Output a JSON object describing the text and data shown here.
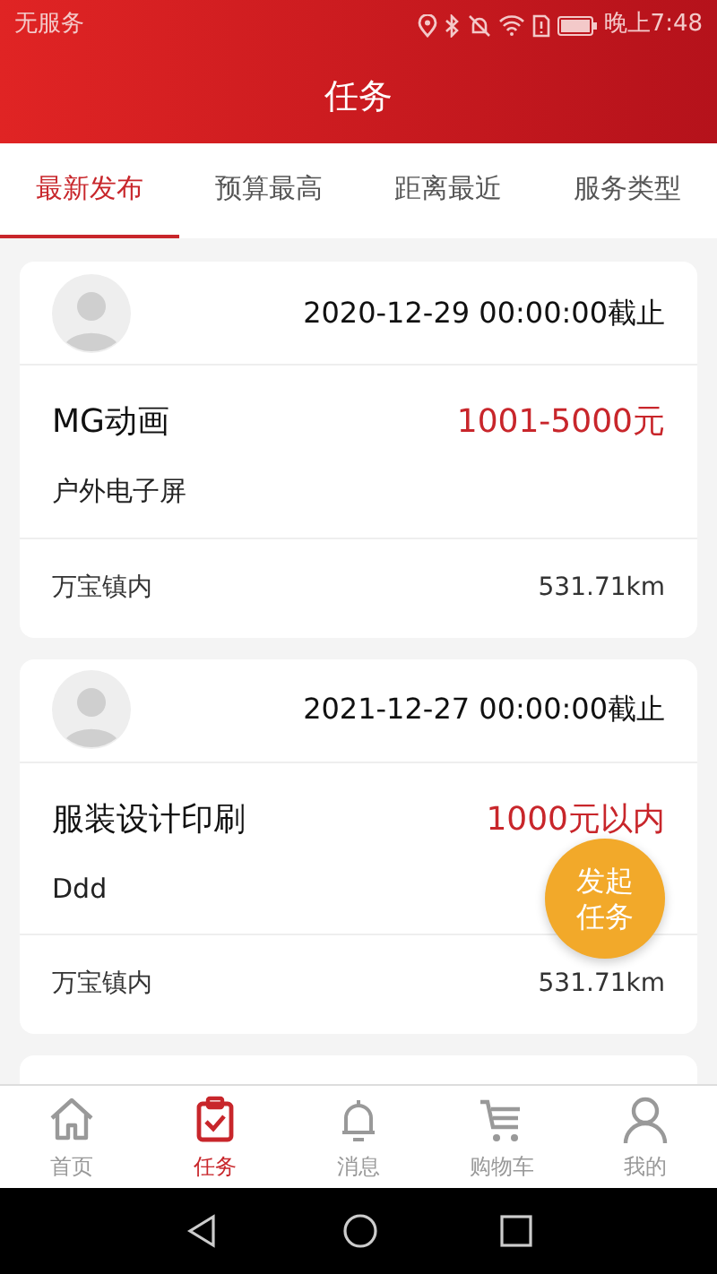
{
  "status_bar": {
    "carrier": "无服务",
    "time": "晚上7:48"
  },
  "header": {
    "title": "任务"
  },
  "tabs": [
    {
      "label": "最新发布",
      "selected": true
    },
    {
      "label": "预算最高",
      "selected": false
    },
    {
      "label": "距离最近",
      "selected": false
    },
    {
      "label": "服务类型",
      "selected": false
    }
  ],
  "tasks": [
    {
      "deadline": "2020-12-29 00:00:00截止",
      "title": "MG动画",
      "budget": "1001-5000元",
      "description": "户外电子屏",
      "location": "万宝镇内",
      "distance": "531.71km"
    },
    {
      "deadline": "2021-12-27 00:00:00截止",
      "title": "服装设计印刷",
      "budget": "1000元以内",
      "description": "Ddd",
      "location": "万宝镇内",
      "distance": "531.71km"
    }
  ],
  "fab": {
    "label": "发起任务"
  },
  "bottom_nav": [
    {
      "kind": "home",
      "label": "首页",
      "selected": false
    },
    {
      "kind": "task",
      "label": "任务",
      "selected": true
    },
    {
      "kind": "bell",
      "label": "消息",
      "selected": false
    },
    {
      "kind": "cart",
      "label": "购物车",
      "selected": false
    },
    {
      "kind": "user",
      "label": "我的",
      "selected": false
    }
  ]
}
